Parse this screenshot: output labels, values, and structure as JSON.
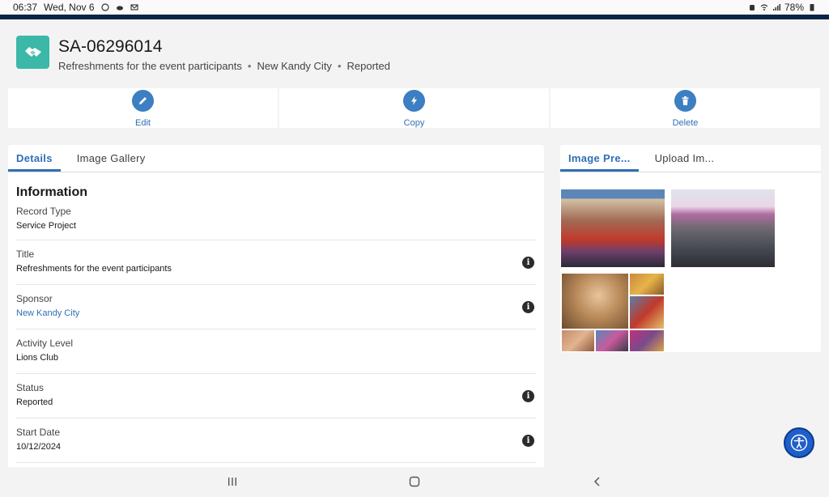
{
  "status_bar": {
    "time": "06:37",
    "date": "Wed, Nov 6",
    "battery": "78%"
  },
  "record": {
    "title": "SA-06296014",
    "subtitle_title": "Refreshments for the event participants",
    "subtitle_sponsor": "New Kandy City",
    "subtitle_status": "Reported",
    "separator": "•",
    "icon": "handshake-icon",
    "icon_color": "#3bb8a8"
  },
  "actions": [
    {
      "label": "Edit",
      "icon": "pencil-icon"
    },
    {
      "label": "Copy",
      "icon": "lightning-icon"
    },
    {
      "label": "Delete",
      "icon": "trash-icon"
    }
  ],
  "left_tabs": [
    {
      "label": "Details",
      "active": true
    },
    {
      "label": "Image Gallery",
      "active": false
    }
  ],
  "right_tabs": [
    {
      "label": "Image Pre...",
      "active": true
    },
    {
      "label": "Upload Im...",
      "active": false
    }
  ],
  "section_title": "Information",
  "fields": [
    {
      "label": "Record Type",
      "value": "Service Project",
      "info": false,
      "link": false
    },
    {
      "label": "Title",
      "value": "Refreshments for the event participants",
      "info": true,
      "link": false
    },
    {
      "label": "Sponsor",
      "value": "New Kandy City",
      "info": true,
      "link": true
    },
    {
      "label": "Activity Level",
      "value": "Lions Club",
      "info": false,
      "link": false
    },
    {
      "label": "Status",
      "value": "Reported",
      "info": true,
      "link": false
    },
    {
      "label": "Start Date",
      "value": "10/12/2024",
      "info": true,
      "link": false
    }
  ],
  "info_glyph": "i",
  "colors": {
    "accent": "#2f6fb5",
    "action_circle": "#3c7fc2",
    "fab": "#1f5fc9",
    "header_band": "#0b2447"
  }
}
